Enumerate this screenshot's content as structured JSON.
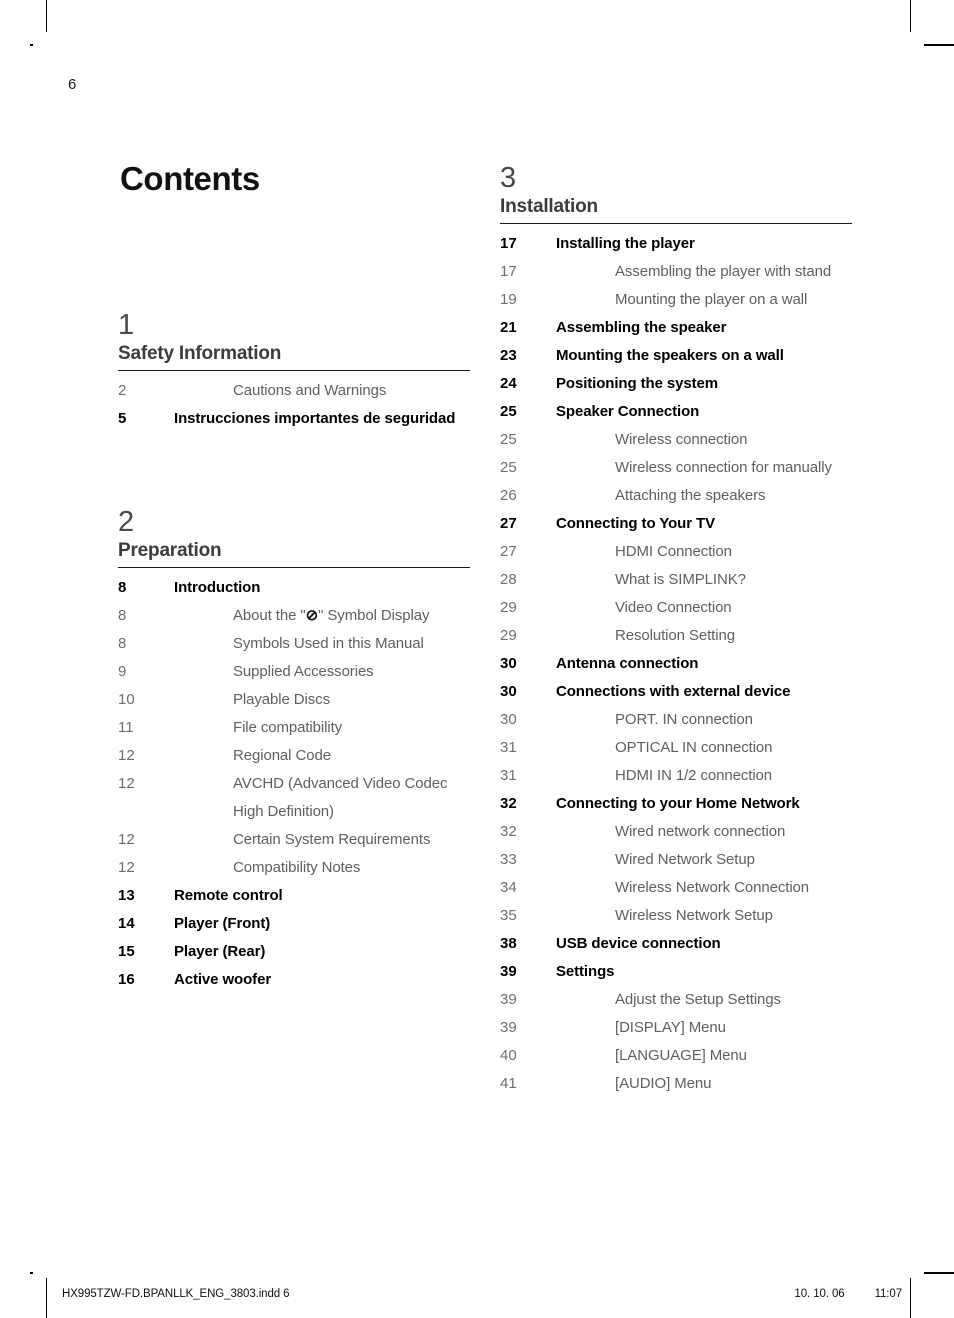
{
  "page": {
    "number": "6",
    "title": "Contents"
  },
  "footer": {
    "filename": "HX995TZW-FD.BPANLLK_ENG_3803.indd   6",
    "date": "10. 10. 06",
    "time": "11:07"
  },
  "symbols": {
    "no_symbol": "⊘"
  },
  "columns": [
    {
      "name": "left",
      "sections": [
        {
          "number": "1",
          "title": "Safety Information",
          "entries": [
            {
              "level": 2,
              "page": "2",
              "label": "Cautions and Warnings"
            },
            {
              "level": 1,
              "page": "5",
              "label": "Instrucciones importantes de seguridad"
            }
          ]
        },
        {
          "number": "2",
          "title": "Preparation",
          "entries": [
            {
              "level": 1,
              "page": "8",
              "label": "Introduction"
            },
            {
              "level": 2,
              "page": "8",
              "label": "About the \"⊘\" Symbol Display",
              "has_symbol": true
            },
            {
              "level": 2,
              "page": "8",
              "label": "Symbols Used in this Manual"
            },
            {
              "level": 2,
              "page": "9",
              "label": "Supplied Accessories"
            },
            {
              "level": 2,
              "page": "10",
              "label": "Playable Discs"
            },
            {
              "level": 2,
              "page": "11",
              "label": "File compatibility"
            },
            {
              "level": 2,
              "page": "12",
              "label": "Regional Code"
            },
            {
              "level": 2,
              "page": "12",
              "label": "AVCHD (Advanced Video Codec High Definition)"
            },
            {
              "level": 2,
              "page": "12",
              "label": "Certain System Requirements"
            },
            {
              "level": 2,
              "page": "12",
              "label": "Compatibility Notes"
            },
            {
              "level": 1,
              "page": "13",
              "label": "Remote control"
            },
            {
              "level": 1,
              "page": "14",
              "label": "Player (Front)"
            },
            {
              "level": 1,
              "page": "15",
              "label": "Player (Rear)"
            },
            {
              "level": 1,
              "page": "16",
              "label": "Active woofer"
            }
          ]
        }
      ]
    },
    {
      "name": "right",
      "sections": [
        {
          "number": "3",
          "title": "Installation",
          "entries": [
            {
              "level": 1,
              "page": "17",
              "label": "Installing the player"
            },
            {
              "level": 2,
              "page": "17",
              "label": "Assembling the player with stand"
            },
            {
              "level": 2,
              "page": "19",
              "label": "Mounting the player on a wall"
            },
            {
              "level": 1,
              "page": "21",
              "label": "Assembling the speaker"
            },
            {
              "level": 1,
              "page": "23",
              "label": "Mounting the speakers on a wall"
            },
            {
              "level": 1,
              "page": "24",
              "label": "Positioning the system"
            },
            {
              "level": 1,
              "page": "25",
              "label": "Speaker Connection"
            },
            {
              "level": 2,
              "page": "25",
              "label": "Wireless connection"
            },
            {
              "level": 2,
              "page": "25",
              "label": "Wireless connection for manually"
            },
            {
              "level": 2,
              "page": "26",
              "label": "Attaching the speakers"
            },
            {
              "level": 1,
              "page": "27",
              "label": "Connecting to Your TV"
            },
            {
              "level": 2,
              "page": "27",
              "label": "HDMI Connection"
            },
            {
              "level": 2,
              "page": "28",
              "label": "What is SIMPLINK?"
            },
            {
              "level": 2,
              "page": "29",
              "label": "Video Connection"
            },
            {
              "level": 2,
              "page": "29",
              "label": "Resolution Setting"
            },
            {
              "level": 1,
              "page": "30",
              "label": "Antenna connection"
            },
            {
              "level": 1,
              "page": "30",
              "label": "Connections with external device"
            },
            {
              "level": 2,
              "page": "30",
              "label": "PORT. IN connection"
            },
            {
              "level": 2,
              "page": "31",
              "label": "OPTICAL IN connection"
            },
            {
              "level": 2,
              "page": "31",
              "label": "HDMI IN 1/2 connection"
            },
            {
              "level": 1,
              "page": "32",
              "label": "Connecting to your Home Network"
            },
            {
              "level": 2,
              "page": "32",
              "label": "Wired network connection"
            },
            {
              "level": 2,
              "page": "33",
              "label": "Wired Network Setup"
            },
            {
              "level": 2,
              "page": "34",
              "label": "Wireless Network Connection"
            },
            {
              "level": 2,
              "page": "35",
              "label": "Wireless Network Setup"
            },
            {
              "level": 1,
              "page": "38",
              "label": "USB device connection"
            },
            {
              "level": 1,
              "page": "39",
              "label": "Settings"
            },
            {
              "level": 2,
              "page": "39",
              "label": "Adjust the Setup Settings"
            },
            {
              "level": 2,
              "page": "39",
              "label": "[DISPLAY] Menu"
            },
            {
              "level": 2,
              "page": "40",
              "label": "[LANGUAGE] Menu"
            },
            {
              "level": 2,
              "page": "41",
              "label": "[AUDIO] Menu"
            }
          ]
        }
      ]
    }
  ]
}
